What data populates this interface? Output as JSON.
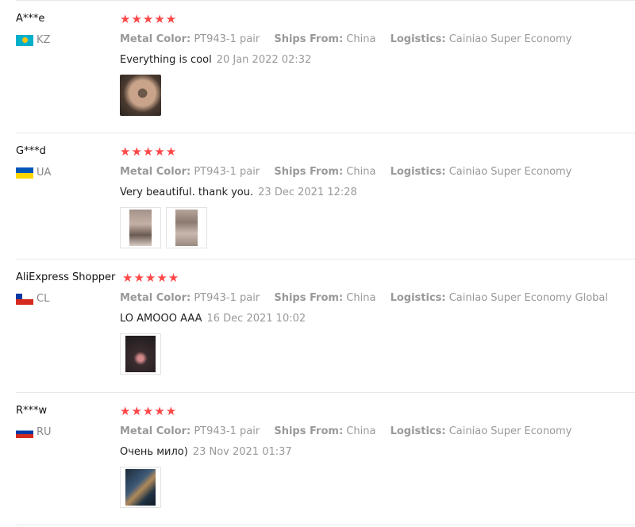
{
  "reviews": [
    {
      "name": "A***e",
      "country": "KZ",
      "flag": "kz",
      "stars": "★★★★★",
      "metal_label": "Metal Color:",
      "metal_value": "PT943-1 pair",
      "ships_label": "Ships From:",
      "ships_value": "China",
      "logistics_label": "Logistics:",
      "logistics_value": "Cainiao Super Economy",
      "text": "Everything is cool",
      "date": "20 Jan 2022 02:32",
      "photos": 1
    },
    {
      "name": "G***d",
      "country": "UA",
      "flag": "ua",
      "stars": "★★★★★",
      "metal_label": "Metal Color:",
      "metal_value": "PT943-1 pair",
      "ships_label": "Ships From:",
      "ships_value": "China",
      "logistics_label": "Logistics:",
      "logistics_value": "Cainiao Super Economy",
      "text": "Very beautiful. thank you.",
      "date": "23 Dec 2021 12:28",
      "photos": 2
    },
    {
      "name": "AliExpress Shopper",
      "country": "CL",
      "flag": "cl",
      "stars": "★★★★★",
      "metal_label": "Metal Color:",
      "metal_value": "PT943-1 pair",
      "ships_label": "Ships From:",
      "ships_value": "China",
      "logistics_label": "Logistics:",
      "logistics_value": "Cainiao Super Economy Global",
      "text": "LO AMOOO AAA",
      "date": "16 Dec 2021 10:02",
      "photos": 1
    },
    {
      "name": "R***w",
      "country": "RU",
      "flag": "ru",
      "stars": "★★★★★",
      "metal_label": "Metal Color:",
      "metal_value": "PT943-1 pair",
      "ships_label": "Ships From:",
      "ships_value": "China",
      "logistics_label": "Logistics:",
      "logistics_value": "Cainiao Super Economy",
      "text": "Очень мило)",
      "date": "23 Nov 2021 01:37",
      "photos": 1
    }
  ],
  "colors": {
    "star": "#ff4747",
    "muted": "#999999",
    "separator": "#e8e8e8"
  }
}
